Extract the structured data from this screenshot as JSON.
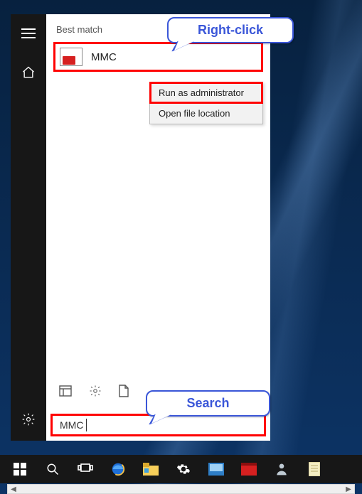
{
  "start": {
    "heading": "Best match",
    "result_label": "MMC",
    "search_value": "MMC"
  },
  "context_menu": {
    "items": [
      {
        "label": "Run as administrator"
      },
      {
        "label": "Open file location"
      }
    ]
  },
  "callouts": {
    "right_click": "Right-click",
    "search": "Search"
  },
  "taskbar": {
    "items": [
      {
        "name": "start"
      },
      {
        "name": "search"
      },
      {
        "name": "task-view"
      },
      {
        "name": "internet-explorer"
      },
      {
        "name": "file-explorer"
      },
      {
        "name": "settings"
      },
      {
        "name": "app-blue"
      },
      {
        "name": "app-red"
      },
      {
        "name": "app-person"
      },
      {
        "name": "notepad"
      }
    ]
  }
}
